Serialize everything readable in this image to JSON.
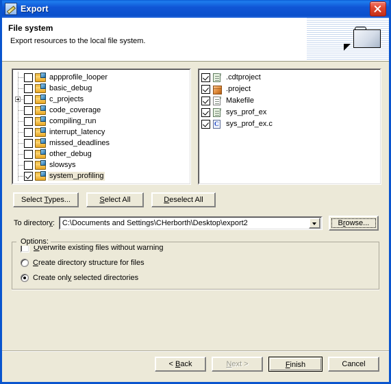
{
  "window": {
    "title": "Export",
    "icon": "export-wizard-icon",
    "close_label": "Close"
  },
  "header": {
    "title": "File system",
    "description": "Export resources to the local file system.",
    "graphic": "folder-with-arrow-icon"
  },
  "tree_panel": {
    "items": [
      {
        "label": "appprofile_looper",
        "checked": false,
        "expandable": false,
        "selected": false
      },
      {
        "label": "basic_debug",
        "checked": false,
        "expandable": false,
        "selected": false
      },
      {
        "label": "c_projects",
        "checked": false,
        "expandable": true,
        "selected": false
      },
      {
        "label": "code_coverage",
        "checked": false,
        "expandable": false,
        "selected": false
      },
      {
        "label": "compiling_run",
        "checked": false,
        "expandable": false,
        "selected": false
      },
      {
        "label": "interrupt_latency",
        "checked": false,
        "expandable": false,
        "selected": false
      },
      {
        "label": "missed_deadlines",
        "checked": false,
        "expandable": false,
        "selected": false
      },
      {
        "label": "other_debug",
        "checked": false,
        "expandable": false,
        "selected": false
      },
      {
        "label": "slowsys",
        "checked": false,
        "expandable": false,
        "selected": false
      },
      {
        "label": "system_profiling",
        "checked": true,
        "expandable": false,
        "selected": true
      }
    ]
  },
  "file_panel": {
    "items": [
      {
        "label": ".cdtproject",
        "checked": true,
        "icon": "document-green-icon"
      },
      {
        "label": ".project",
        "checked": true,
        "icon": "project-box-icon"
      },
      {
        "label": "Makefile",
        "checked": true,
        "icon": "document-plain-icon"
      },
      {
        "label": "sys_prof_ex",
        "checked": true,
        "icon": "document-green-icon"
      },
      {
        "label": "sys_prof_ex.c",
        "checked": true,
        "icon": "c-source-file-icon"
      }
    ]
  },
  "selection_buttons": {
    "select_types": {
      "pre": "Select ",
      "mnemonic": "T",
      "post": "ypes..."
    },
    "select_all": {
      "pre": "",
      "mnemonic": "S",
      "post": "elect All"
    },
    "deselect_all": {
      "pre": "",
      "mnemonic": "D",
      "post": "eselect All"
    }
  },
  "directory": {
    "label_pre": "To director",
    "label_mnemonic": "y",
    "label_post": ":",
    "value": "C:\\Documents and Settings\\CHerborth\\Desktop\\export2",
    "placeholder": "",
    "browse": {
      "pre": "B",
      "mnemonic": "r",
      "post": "owse..."
    }
  },
  "options": {
    "title": "Options:",
    "items": [
      {
        "type": "checkbox",
        "checked": false,
        "selected": false,
        "pre": "",
        "mnemonic": "O",
        "post": "verwrite existing files without warning"
      },
      {
        "type": "radio",
        "checked": false,
        "selected": false,
        "pre": "",
        "mnemonic": "C",
        "post": "reate directory structure for files"
      },
      {
        "type": "radio",
        "checked": true,
        "selected": true,
        "pre": "Create onl",
        "mnemonic": "y",
        "post": " selected directories"
      }
    ]
  },
  "footer": {
    "back": {
      "pre": "< ",
      "mnemonic": "B",
      "post": "ack",
      "disabled": false,
      "default": false
    },
    "next": {
      "pre": "",
      "mnemonic": "N",
      "post": "ext >",
      "disabled": true,
      "default": false
    },
    "finish": {
      "pre": "",
      "mnemonic": "F",
      "post": "inish",
      "disabled": false,
      "default": true
    },
    "cancel": {
      "pre": "Cancel",
      "mnemonic": "",
      "post": "",
      "disabled": false,
      "default": false
    }
  },
  "colors": {
    "dialog_background": "#ECE9D8",
    "title_bar_blue": "#0A55CE",
    "close_red": "#C32D16",
    "selection_highlight": "#EDE7D4",
    "panel_white": "#FFFFFF"
  }
}
